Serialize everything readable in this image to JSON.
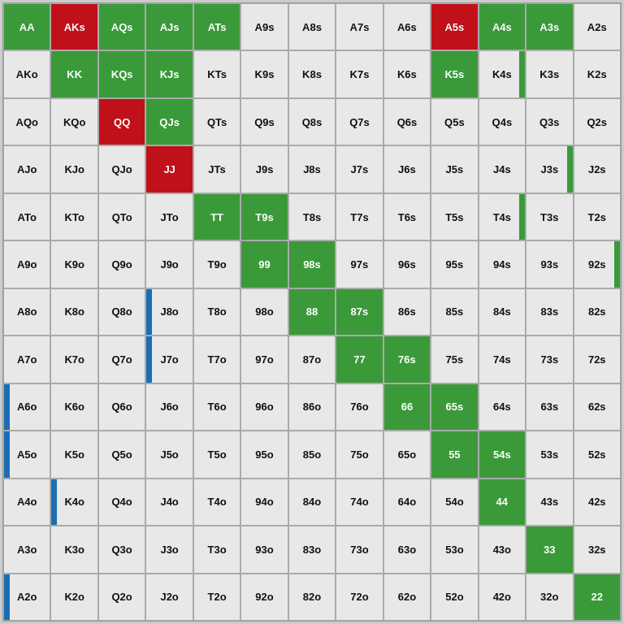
{
  "cells": [
    {
      "label": "AA",
      "style": "green"
    },
    {
      "label": "AKs",
      "style": "red"
    },
    {
      "label": "AQs",
      "style": "green"
    },
    {
      "label": "AJs",
      "style": "green"
    },
    {
      "label": "ATs",
      "style": "green"
    },
    {
      "label": "A9s",
      "style": ""
    },
    {
      "label": "A8s",
      "style": ""
    },
    {
      "label": "A7s",
      "style": ""
    },
    {
      "label": "A6s",
      "style": ""
    },
    {
      "label": "A5s",
      "style": "red"
    },
    {
      "label": "A4s",
      "style": "green"
    },
    {
      "label": "A3s",
      "style": "green"
    },
    {
      "label": "A2s",
      "style": ""
    },
    {
      "label": "AKo",
      "style": ""
    },
    {
      "label": "KK",
      "style": "green"
    },
    {
      "label": "KQs",
      "style": "green"
    },
    {
      "label": "KJs",
      "style": "green"
    },
    {
      "label": "KTs",
      "style": ""
    },
    {
      "label": "K9s",
      "style": ""
    },
    {
      "label": "K8s",
      "style": ""
    },
    {
      "label": "K7s",
      "style": ""
    },
    {
      "label": "K6s",
      "style": ""
    },
    {
      "label": "K5s",
      "style": "green"
    },
    {
      "label": "K4s",
      "style": ""
    },
    {
      "label": "K3s",
      "style": ""
    },
    {
      "label": "K2s",
      "style": ""
    },
    {
      "label": "AQo",
      "style": ""
    },
    {
      "label": "KQo",
      "style": ""
    },
    {
      "label": "QQ",
      "style": "red"
    },
    {
      "label": "QJs",
      "style": "green"
    },
    {
      "label": "QTs",
      "style": ""
    },
    {
      "label": "Q9s",
      "style": ""
    },
    {
      "label": "Q8s",
      "style": ""
    },
    {
      "label": "Q7s",
      "style": ""
    },
    {
      "label": "Q6s",
      "style": ""
    },
    {
      "label": "Q5s",
      "style": ""
    },
    {
      "label": "Q4s",
      "style": ""
    },
    {
      "label": "Q3s",
      "style": ""
    },
    {
      "label": "Q2s",
      "style": ""
    },
    {
      "label": "AJo",
      "style": ""
    },
    {
      "label": "KJo",
      "style": ""
    },
    {
      "label": "QJo",
      "style": ""
    },
    {
      "label": "JJ",
      "style": "red"
    },
    {
      "label": "JTs",
      "style": ""
    },
    {
      "label": "J9s",
      "style": ""
    },
    {
      "label": "J8s",
      "style": ""
    },
    {
      "label": "J7s",
      "style": ""
    },
    {
      "label": "J6s",
      "style": ""
    },
    {
      "label": "J5s",
      "style": ""
    },
    {
      "label": "J4s",
      "style": ""
    },
    {
      "label": "J3s",
      "style": "blue-right"
    },
    {
      "label": "J2s",
      "style": ""
    },
    {
      "label": "ATo",
      "style": ""
    },
    {
      "label": "KTo",
      "style": ""
    },
    {
      "label": "QTo",
      "style": ""
    },
    {
      "label": "JTo",
      "style": ""
    },
    {
      "label": "TT",
      "style": "green"
    },
    {
      "label": "T9s",
      "style": "green"
    },
    {
      "label": "T8s",
      "style": ""
    },
    {
      "label": "T7s",
      "style": ""
    },
    {
      "label": "T6s",
      "style": ""
    },
    {
      "label": "T5s",
      "style": ""
    },
    {
      "label": "T4s",
      "style": "blue-right"
    },
    {
      "label": "T3s",
      "style": ""
    },
    {
      "label": "T2s",
      "style": ""
    },
    {
      "label": "A9o",
      "style": ""
    },
    {
      "label": "K9o",
      "style": ""
    },
    {
      "label": "Q9o",
      "style": ""
    },
    {
      "label": "J9o",
      "style": ""
    },
    {
      "label": "T9o",
      "style": ""
    },
    {
      "label": "99",
      "style": "green"
    },
    {
      "label": "98s",
      "style": "green"
    },
    {
      "label": "97s",
      "style": ""
    },
    {
      "label": "96s",
      "style": ""
    },
    {
      "label": "95s",
      "style": ""
    },
    {
      "label": "94s",
      "style": ""
    },
    {
      "label": "93s",
      "style": ""
    },
    {
      "label": "92s",
      "style": "blue-right"
    },
    {
      "label": "A8o",
      "style": ""
    },
    {
      "label": "K8o",
      "style": ""
    },
    {
      "label": "Q8o",
      "style": ""
    },
    {
      "label": "J8o",
      "style": "blue-left"
    },
    {
      "label": "T8o",
      "style": ""
    },
    {
      "label": "98o",
      "style": ""
    },
    {
      "label": "88",
      "style": "green"
    },
    {
      "label": "87s",
      "style": "green"
    },
    {
      "label": "86s",
      "style": ""
    },
    {
      "label": "85s",
      "style": ""
    },
    {
      "label": "84s",
      "style": ""
    },
    {
      "label": "83s",
      "style": ""
    },
    {
      "label": "82s",
      "style": ""
    },
    {
      "label": "A7o",
      "style": ""
    },
    {
      "label": "K7o",
      "style": ""
    },
    {
      "label": "Q7o",
      "style": ""
    },
    {
      "label": "J7o",
      "style": "blue-left"
    },
    {
      "label": "T7o",
      "style": ""
    },
    {
      "label": "97o",
      "style": ""
    },
    {
      "label": "87o",
      "style": ""
    },
    {
      "label": "77",
      "style": "green"
    },
    {
      "label": "76s",
      "style": "green"
    },
    {
      "label": "75s",
      "style": ""
    },
    {
      "label": "74s",
      "style": ""
    },
    {
      "label": "73s",
      "style": ""
    },
    {
      "label": "72s",
      "style": ""
    },
    {
      "label": "A6o",
      "style": "blue-left"
    },
    {
      "label": "K6o",
      "style": ""
    },
    {
      "label": "Q6o",
      "style": ""
    },
    {
      "label": "J6o",
      "style": ""
    },
    {
      "label": "T6o",
      "style": ""
    },
    {
      "label": "96o",
      "style": ""
    },
    {
      "label": "86o",
      "style": ""
    },
    {
      "label": "76o",
      "style": ""
    },
    {
      "label": "66",
      "style": "green"
    },
    {
      "label": "65s",
      "style": "green"
    },
    {
      "label": "64s",
      "style": ""
    },
    {
      "label": "63s",
      "style": ""
    },
    {
      "label": "62s",
      "style": ""
    },
    {
      "label": "A5o",
      "style": "blue-left"
    },
    {
      "label": "K5o",
      "style": ""
    },
    {
      "label": "Q5o",
      "style": ""
    },
    {
      "label": "J5o",
      "style": ""
    },
    {
      "label": "T5o",
      "style": ""
    },
    {
      "label": "95o",
      "style": ""
    },
    {
      "label": "85o",
      "style": ""
    },
    {
      "label": "75o",
      "style": ""
    },
    {
      "label": "65o",
      "style": ""
    },
    {
      "label": "55",
      "style": "green"
    },
    {
      "label": "54s",
      "style": "green"
    },
    {
      "label": "53s",
      "style": ""
    },
    {
      "label": "52s",
      "style": ""
    },
    {
      "label": "A4o",
      "style": ""
    },
    {
      "label": "K4o",
      "style": "blue-left"
    },
    {
      "label": "Q4o",
      "style": ""
    },
    {
      "label": "J4o",
      "style": ""
    },
    {
      "label": "T4o",
      "style": ""
    },
    {
      "label": "94o",
      "style": ""
    },
    {
      "label": "84o",
      "style": ""
    },
    {
      "label": "74o",
      "style": ""
    },
    {
      "label": "64o",
      "style": ""
    },
    {
      "label": "54o",
      "style": ""
    },
    {
      "label": "44",
      "style": "green"
    },
    {
      "label": "43s",
      "style": ""
    },
    {
      "label": "42s",
      "style": ""
    },
    {
      "label": "A3o",
      "style": ""
    },
    {
      "label": "K3o",
      "style": ""
    },
    {
      "label": "Q3o",
      "style": ""
    },
    {
      "label": "J3o",
      "style": ""
    },
    {
      "label": "T3o",
      "style": ""
    },
    {
      "label": "93o",
      "style": ""
    },
    {
      "label": "83o",
      "style": ""
    },
    {
      "label": "73o",
      "style": ""
    },
    {
      "label": "63o",
      "style": ""
    },
    {
      "label": "53o",
      "style": ""
    },
    {
      "label": "43o",
      "style": ""
    },
    {
      "label": "33",
      "style": "green"
    },
    {
      "label": "32s",
      "style": ""
    },
    {
      "label": "A2o",
      "style": "blue-left"
    },
    {
      "label": "K2o",
      "style": ""
    },
    {
      "label": "Q2o",
      "style": ""
    },
    {
      "label": "J2o",
      "style": ""
    },
    {
      "label": "T2o",
      "style": ""
    },
    {
      "label": "92o",
      "style": ""
    },
    {
      "label": "82o",
      "style": ""
    },
    {
      "label": "72o",
      "style": ""
    },
    {
      "label": "62o",
      "style": ""
    },
    {
      "label": "52o",
      "style": ""
    },
    {
      "label": "42o",
      "style": ""
    },
    {
      "label": "32o",
      "style": ""
    },
    {
      "label": "22",
      "style": "green"
    }
  ]
}
